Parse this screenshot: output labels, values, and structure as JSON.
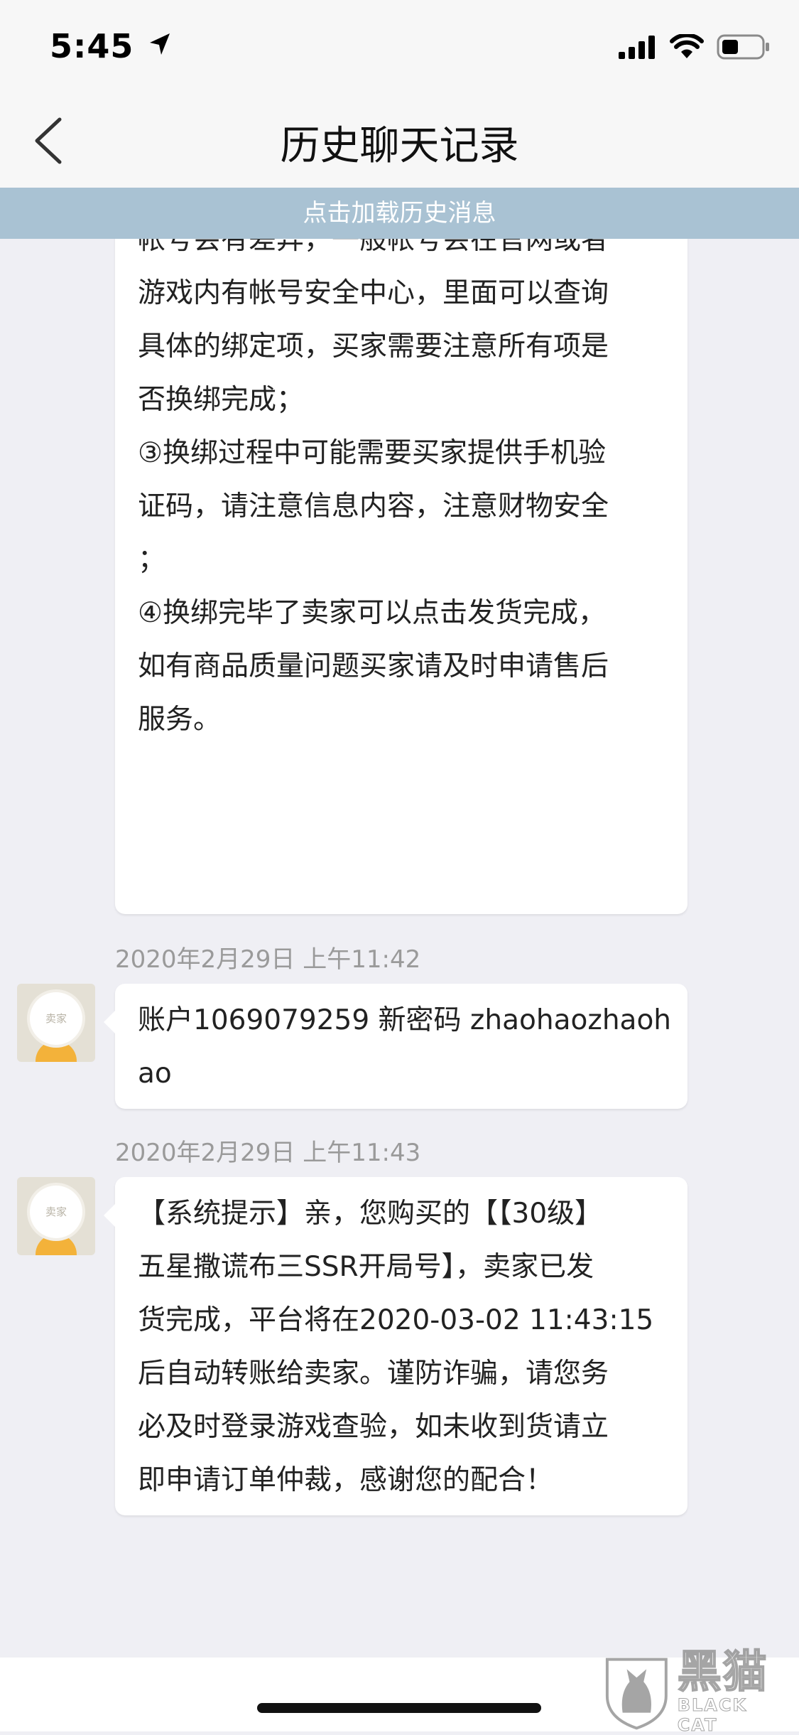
{
  "status_bar": {
    "time": "5:45"
  },
  "nav": {
    "title": "历史聊天记录"
  },
  "load_history_label": "点击加载历史消息",
  "messages": [
    {
      "lines": [
        "帐号会有差异，一般帐号会在官网或者",
        "游戏内有帐号安全中心，里面可以查询",
        "具体的绑定项，买家需要注意所有项是",
        "否换绑完成；",
        "③换绑过程中可能需要买家提供手机验",
        "证码，请注意信息内容，注意财物安全",
        "；",
        "④换绑完毕了卖家可以点击发货完成，",
        "如有商品质量问题买家请及时申请售后",
        "服务。"
      ]
    },
    {
      "timestamp": "2020年2月29日 上午11:42",
      "avatar_label": "卖家",
      "lines": [
        "账户1069079259 新密码 zhaohaozhaoh",
        "ao"
      ]
    },
    {
      "timestamp": "2020年2月29日 上午11:43",
      "avatar_label": "卖家",
      "lines": [
        "【系统提示】亲，您购买的【【30级】",
        "五星撒谎布三SSR开局号】，卖家已发",
        "货完成，平台将在2020-03-02 11:43:15",
        "后自动转账给卖家。谨防诈骗，请您务",
        "必及时登录游戏查验，如未收到货请立",
        "即申请订单仲裁，感谢您的配合！"
      ]
    }
  ],
  "watermark": {
    "cn": "黑猫",
    "en": "BLACK CAT"
  },
  "colors": {
    "load_bar": "#a9c2d3",
    "background": "#efeff4",
    "avatar_body": "#f3b23a"
  }
}
